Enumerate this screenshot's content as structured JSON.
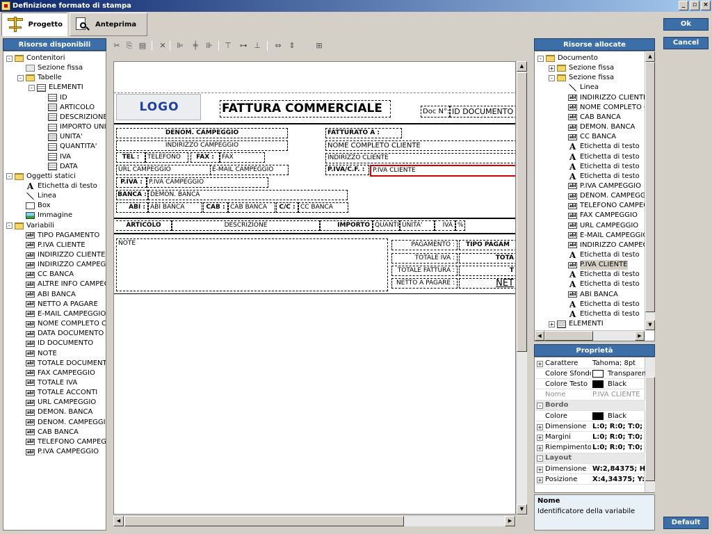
{
  "window": {
    "title": "Definizione formato di stampa",
    "btn_min": "_",
    "btn_max": "▫",
    "btn_close": "×"
  },
  "toolbar": {
    "progetto": "Progetto",
    "anteprima": "Anteprima"
  },
  "left_panel": {
    "title": "Risorse disponibili",
    "items": [
      {
        "label": "Contenitori",
        "icon": "folder-icon",
        "indent": 0,
        "exp": "-"
      },
      {
        "label": "Sezione fissa",
        "icon": "section-icon",
        "indent": 1,
        "exp": ""
      },
      {
        "label": "Tabelle",
        "icon": "folder-icon",
        "indent": 1,
        "exp": "-"
      },
      {
        "label": "ELEMENTI",
        "icon": "table-icon",
        "indent": 2,
        "exp": "-"
      },
      {
        "label": "ID",
        "icon": "column-icon",
        "indent": 3,
        "exp": ""
      },
      {
        "label": "ARTICOLO",
        "icon": "column-icon",
        "indent": 3,
        "exp": ""
      },
      {
        "label": "DESCRIZIONE",
        "icon": "column-icon",
        "indent": 3,
        "exp": ""
      },
      {
        "label": "IMPORTO UNITARIO",
        "icon": "column-icon",
        "indent": 3,
        "exp": ""
      },
      {
        "label": "UNITA'",
        "icon": "column-icon",
        "indent": 3,
        "exp": ""
      },
      {
        "label": "QUANTITA'",
        "icon": "column-icon",
        "indent": 3,
        "exp": ""
      },
      {
        "label": "IVA",
        "icon": "column-icon",
        "indent": 3,
        "exp": ""
      },
      {
        "label": "DATA",
        "icon": "column-icon",
        "indent": 3,
        "exp": ""
      },
      {
        "label": "Oggetti statici",
        "icon": "folder-icon",
        "indent": 0,
        "exp": "-"
      },
      {
        "label": "Etichetta di testo",
        "icon": "text-label-icon",
        "indent": 1,
        "exp": ""
      },
      {
        "label": "Linea",
        "icon": "line-icon",
        "indent": 1,
        "exp": ""
      },
      {
        "label": "Box",
        "icon": "box-icon",
        "indent": 1,
        "exp": ""
      },
      {
        "label": "Immagine",
        "icon": "image-icon",
        "indent": 1,
        "exp": ""
      },
      {
        "label": "Variabili",
        "icon": "folder-icon",
        "indent": 0,
        "exp": "-"
      },
      {
        "label": "TIPO PAGAMENTO",
        "icon": "variable-icon",
        "indent": 1,
        "exp": ""
      },
      {
        "label": "P.IVA CLIENTE",
        "icon": "variable-icon",
        "indent": 1,
        "exp": ""
      },
      {
        "label": "INDIRIZZO CLIENTE",
        "icon": "variable-icon",
        "indent": 1,
        "exp": ""
      },
      {
        "label": "INDIRIZZO CAMPEGGIO",
        "icon": "variable-icon",
        "indent": 1,
        "exp": ""
      },
      {
        "label": "CC BANCA",
        "icon": "variable-icon",
        "indent": 1,
        "exp": ""
      },
      {
        "label": "ALTRE INFO CAMPEGGIO",
        "icon": "variable-icon",
        "indent": 1,
        "exp": ""
      },
      {
        "label": "ABI BANCA",
        "icon": "variable-icon",
        "indent": 1,
        "exp": ""
      },
      {
        "label": "NETTO A PAGARE",
        "icon": "variable-icon",
        "indent": 1,
        "exp": ""
      },
      {
        "label": "E-MAIL CAMPEGGIO",
        "icon": "variable-icon",
        "indent": 1,
        "exp": ""
      },
      {
        "label": "NOME COMPLETO CLIENTE",
        "icon": "variable-icon",
        "indent": 1,
        "exp": ""
      },
      {
        "label": "DATA DOCUMENTO",
        "icon": "variable-icon",
        "indent": 1,
        "exp": ""
      },
      {
        "label": "ID DOCUMENTO",
        "icon": "variable-icon",
        "indent": 1,
        "exp": ""
      },
      {
        "label": "NOTE",
        "icon": "variable-icon",
        "indent": 1,
        "exp": ""
      },
      {
        "label": "TOTALE DOCUMENTO",
        "icon": "variable-icon",
        "indent": 1,
        "exp": ""
      },
      {
        "label": "FAX CAMPEGGIO",
        "icon": "variable-icon",
        "indent": 1,
        "exp": ""
      },
      {
        "label": "TOTALE IVA",
        "icon": "variable-icon",
        "indent": 1,
        "exp": ""
      },
      {
        "label": "TOTALE ACCONTI",
        "icon": "variable-icon",
        "indent": 1,
        "exp": ""
      },
      {
        "label": "URL CAMPEGGIO",
        "icon": "variable-icon",
        "indent": 1,
        "exp": ""
      },
      {
        "label": "DEMON. BANCA",
        "icon": "variable-icon",
        "indent": 1,
        "exp": ""
      },
      {
        "label": "DENOM. CAMPEGGIO",
        "icon": "variable-icon",
        "indent": 1,
        "exp": ""
      },
      {
        "label": "CAB BANCA",
        "icon": "variable-icon",
        "indent": 1,
        "exp": ""
      },
      {
        "label": "TELEFONO CAMPEGGIO",
        "icon": "variable-icon",
        "indent": 1,
        "exp": ""
      },
      {
        "label": "P.IVA CAMPEGGIO",
        "icon": "variable-icon",
        "indent": 1,
        "exp": ""
      }
    ]
  },
  "edit_toolbar": [
    "cut-icon",
    "copy-icon",
    "paste-icon",
    "delete-icon",
    "align-left-icon",
    "align-center-icon",
    "align-right-icon",
    "align-top-icon",
    "align-middle-icon",
    "align-bottom-icon",
    "same-width-icon",
    "same-height-icon",
    "same-size-icon"
  ],
  "report": {
    "logo": "LOGO",
    "title": "FATTURA COMMERCIALE",
    "doc_no_label": "Doc N°:",
    "doc_no_value": "ID DOCUMENTO",
    "denom_campeggio": "DENOM. CAMPEGGIO",
    "indirizzo_campeggio": "INDIRIZZO CAMPEGGIO",
    "tel_label": "TEL :",
    "tel_value": "TELEFONO",
    "fax_label": "FAX :",
    "fax_value": "FAX",
    "url": "URL CAMPEGGIO",
    "email": "E-MAIL CAMPEGGIO",
    "piva_label": "P.IVA :",
    "piva_value": "P.IVA CAMPEGGIO",
    "banca_label": "BANCA :",
    "banca_value": "DEMON. BANCA",
    "abi_label": "ABI :",
    "abi_value": "ABI BANCA",
    "cab_label": "CAB :",
    "cab_value": "CAB BANCA",
    "cc_label": "C/C :",
    "cc_value": "CC BANCA",
    "fatturato_label": "FATTURATO A :",
    "nome_cliente": "NOME  COMPLETO  CLIENTE",
    "indirizzo_cliente": "INDIRIZZO CLIENTE",
    "piva_cf_label": "P.IVA/C.F. :",
    "piva_cliente": "P.IVA CLIENTE",
    "col_articolo": "ARTICOLO",
    "col_descrizione": "DESCRIZIONE",
    "col_importo": "IMPORTO",
    "col_quanti": "QUANTI",
    "col_unita": "UNITA'",
    "col_iva": "IVA",
    "col_pct": "%",
    "note": "NOTE",
    "pagamento_label": "PAGAMENTO :",
    "pagamento_value": "TIPO PAGAM",
    "totale_iva_label": "TOTALE IVA :",
    "totale_iva_value": "TOTA",
    "totale_fattura_label": "TOTALE FATTURA :",
    "totale_fattura_value": "T",
    "netto_label": "NETTO A PAGARE :",
    "netto_value": "NET"
  },
  "right_panel": {
    "title": "Risorse allocate",
    "items": [
      {
        "label": "Documento",
        "icon": "folder-icon",
        "indent": 0,
        "exp": "-"
      },
      {
        "label": "Sezione fissa",
        "icon": "folder-icon",
        "indent": 1,
        "exp": "+"
      },
      {
        "label": "Sezione fissa",
        "icon": "folder-icon",
        "indent": 1,
        "exp": "-"
      },
      {
        "label": "Linea",
        "icon": "line-icon",
        "indent": 2,
        "exp": ""
      },
      {
        "label": "INDIRIZZO CLIENTE",
        "icon": "variable-icon",
        "indent": 2,
        "exp": ""
      },
      {
        "label": "NOME COMPLETO CLIENTE",
        "icon": "variable-icon",
        "indent": 2,
        "exp": ""
      },
      {
        "label": "CAB BANCA",
        "icon": "variable-icon",
        "indent": 2,
        "exp": ""
      },
      {
        "label": "DEMON. BANCA",
        "icon": "variable-icon",
        "indent": 2,
        "exp": ""
      },
      {
        "label": "CC BANCA",
        "icon": "variable-icon",
        "indent": 2,
        "exp": ""
      },
      {
        "label": "Etichetta di testo",
        "icon": "text-label-icon",
        "indent": 2,
        "exp": ""
      },
      {
        "label": "Etichetta di testo",
        "icon": "text-label-icon",
        "indent": 2,
        "exp": ""
      },
      {
        "label": "Etichetta di testo",
        "icon": "text-label-icon",
        "indent": 2,
        "exp": ""
      },
      {
        "label": "Etichetta di testo",
        "icon": "text-label-icon",
        "indent": 2,
        "exp": ""
      },
      {
        "label": "P.IVA CAMPEGGIO",
        "icon": "variable-icon",
        "indent": 2,
        "exp": ""
      },
      {
        "label": "DENOM. CAMPEGGIO",
        "icon": "variable-icon",
        "indent": 2,
        "exp": ""
      },
      {
        "label": "TELEFONO CAMPEGGIO",
        "icon": "variable-icon",
        "indent": 2,
        "exp": ""
      },
      {
        "label": "FAX CAMPEGGIO",
        "icon": "variable-icon",
        "indent": 2,
        "exp": ""
      },
      {
        "label": "URL CAMPEGGIO",
        "icon": "variable-icon",
        "indent": 2,
        "exp": ""
      },
      {
        "label": "E-MAIL CAMPEGGIO",
        "icon": "variable-icon",
        "indent": 2,
        "exp": ""
      },
      {
        "label": "INDIRIZZO CAMPEGGIO",
        "icon": "variable-icon",
        "indent": 2,
        "exp": ""
      },
      {
        "label": "Etichetta di testo",
        "icon": "text-label-icon",
        "indent": 2,
        "exp": ""
      },
      {
        "label": "P.IVA CLIENTE",
        "icon": "variable-icon",
        "indent": 2,
        "exp": "",
        "selected": true
      },
      {
        "label": "Etichetta di testo",
        "icon": "text-label-icon",
        "indent": 2,
        "exp": ""
      },
      {
        "label": "Etichetta di testo",
        "icon": "text-label-icon",
        "indent": 2,
        "exp": ""
      },
      {
        "label": "ABI BANCA",
        "icon": "variable-icon",
        "indent": 2,
        "exp": ""
      },
      {
        "label": "Etichetta di testo",
        "icon": "text-label-icon",
        "indent": 2,
        "exp": ""
      },
      {
        "label": "Etichetta di testo",
        "icon": "text-label-icon",
        "indent": 2,
        "exp": ""
      },
      {
        "label": "ELEMENTI",
        "icon": "table-icon",
        "indent": 1,
        "exp": "+"
      }
    ]
  },
  "properties": {
    "title": "Proprietà",
    "rows": [
      {
        "type": "prop",
        "plus": "+",
        "key": "Carattere",
        "value": "Tahoma; 8pt"
      },
      {
        "type": "prop",
        "plus": "",
        "key": "Colore Sfondo",
        "value": "Transparent",
        "swatch": "#ffffff"
      },
      {
        "type": "prop",
        "plus": "",
        "key": "Colore Testo",
        "value": "Black",
        "swatch": "#000000"
      },
      {
        "type": "prop",
        "plus": "",
        "key": "Nome",
        "value": "P.IVA CLIENTE",
        "disabled": true
      },
      {
        "type": "cat",
        "key": "Bordo"
      },
      {
        "type": "prop",
        "plus": "",
        "key": "Colore",
        "value": "Black",
        "swatch": "#000000"
      },
      {
        "type": "prop",
        "plus": "+",
        "key": "Dimensione",
        "value": "L:0; R:0; T:0;"
      },
      {
        "type": "prop",
        "plus": "+",
        "key": "Margini",
        "value": "L:0; R:0; T:0;"
      },
      {
        "type": "prop",
        "plus": "+",
        "key": "Riempimento",
        "value": "L:0; R:0; T:0;"
      },
      {
        "type": "cat",
        "key": "Layout"
      },
      {
        "type": "prop",
        "plus": "+",
        "key": "Dimensione",
        "value": "W:2,84375; H"
      },
      {
        "type": "prop",
        "plus": "+",
        "key": "Posizione",
        "value": "X:4,34375; Y:"
      }
    ],
    "help_title": "Nome",
    "help_text": "Identificatore della variabile"
  },
  "buttons": {
    "ok": "Ok",
    "cancel": "Cancel",
    "default": "Default"
  },
  "colors": {
    "accent": "#3c6fa8",
    "selection_red": "#d00000"
  }
}
